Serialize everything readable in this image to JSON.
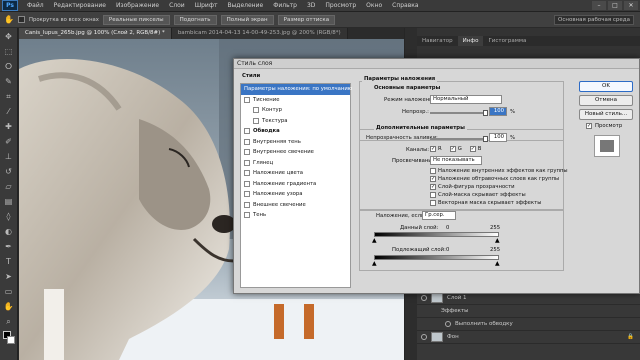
{
  "menubar": {
    "logo": "Ps",
    "items": [
      "Файл",
      "Редактирование",
      "Изображение",
      "Слои",
      "Шрифт",
      "Выделение",
      "Фильтр",
      "3D",
      "Просмотр",
      "Окно",
      "Справка"
    ]
  },
  "options_bar": {
    "checkbox_label": "Прокрутка во всех окнах",
    "buttons": [
      "Реальные пикселы",
      "Подогнать",
      "Полный экран",
      "Размер оттиска"
    ],
    "workspace": "Основная рабочая среда"
  },
  "doc_tabs": [
    {
      "label": "Canis_lupus_265b.jpg @ 100% (Слой 2, RGB/8#) *",
      "active": true
    },
    {
      "label": "bambicam 2014-04-13 14-00-49-253.jpg @ 200% (RGB/8*)",
      "active": false
    }
  ],
  "panels": {
    "tabs": [
      "Навигатор",
      "Инфо",
      "Гистограмма"
    ],
    "active_tab": "Инфо"
  },
  "layers": {
    "rows": [
      {
        "name": "Слой 1"
      },
      {
        "name": "Эффекты"
      },
      {
        "name": "Выполнить обводку"
      },
      {
        "name": "Фон"
      }
    ]
  },
  "dialog": {
    "title": "Стиль слоя",
    "styles_header": "Стили",
    "styles": [
      {
        "label": "Параметры наложения: по умолчанию",
        "selected": true,
        "checkbox": false,
        "indent": 0
      },
      {
        "label": "Тиснение",
        "selected": false,
        "checkbox": true,
        "indent": 0
      },
      {
        "label": "Контур",
        "selected": false,
        "checkbox": true,
        "indent": 1
      },
      {
        "label": "Текстура",
        "selected": false,
        "checkbox": true,
        "indent": 1
      },
      {
        "label": "Обводка",
        "selected": false,
        "checkbox": true,
        "indent": 0,
        "bold": true
      },
      {
        "label": "Внутренняя тень",
        "selected": false,
        "checkbox": true,
        "indent": 0
      },
      {
        "label": "Внутреннее свечение",
        "selected": false,
        "checkbox": true,
        "indent": 0
      },
      {
        "label": "Глянец",
        "selected": false,
        "checkbox": true,
        "indent": 0
      },
      {
        "label": "Наложение цвета",
        "selected": false,
        "checkbox": true,
        "indent": 0
      },
      {
        "label": "Наложение градиента",
        "selected": false,
        "checkbox": true,
        "indent": 0
      },
      {
        "label": "Наложение узора",
        "selected": false,
        "checkbox": true,
        "indent": 0
      },
      {
        "label": "Внешнее свечение",
        "selected": false,
        "checkbox": true,
        "indent": 0
      },
      {
        "label": "Тень",
        "selected": false,
        "checkbox": true,
        "indent": 0
      }
    ],
    "blend": {
      "section_title": "Параметры наложения",
      "basic_title": "Основные параметры",
      "mode_label": "Режим наложения:",
      "mode_value": "Нормальный",
      "opacity_label": "Непрозр.:",
      "opacity_value": "100",
      "unit": "%",
      "advanced_title": "Дополнительные параметры",
      "fill_label": "Непрозрачность заливки:",
      "fill_value": "100",
      "fill_unit": "%",
      "channels_label": "Каналы:",
      "channels": [
        "R",
        "G",
        "B"
      ],
      "knockout_label": "Просвечивание:",
      "knockout_value": "Не показывать",
      "options": [
        {
          "label": "Наложение внутренних эффектов как группы",
          "checked": false
        },
        {
          "label": "Наложение обтравочных слоев как группы",
          "checked": true
        },
        {
          "label": "Слой-фигура прозрачности",
          "checked": true
        },
        {
          "label": "Слой-маска скрывает эффекты",
          "checked": false
        },
        {
          "label": "Векторная маска скрывает эффекты",
          "checked": false
        }
      ],
      "blend_if_label": "Наложение, если:",
      "blend_if_value": "Гр.сер.",
      "this_layer_label": "Данный слой:",
      "this_low": "0",
      "this_high": "255",
      "underlying_label": "Подлежащий слой:",
      "under_low": "0",
      "under_high": "255"
    },
    "buttons": {
      "ok": "OK",
      "cancel": "Отмена",
      "new_style": "Новый стиль...",
      "preview": "Просмотр"
    }
  }
}
